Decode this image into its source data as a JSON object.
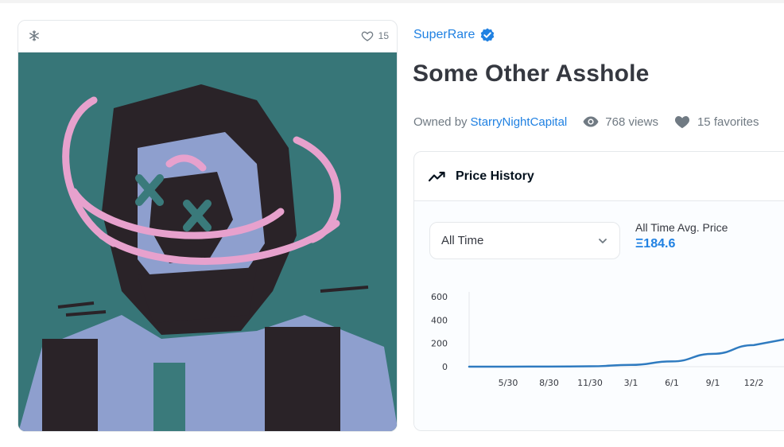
{
  "nft_card": {
    "chain_icon": "snowflake-icon",
    "favorite_icon": "heart-outline-icon",
    "favorite_count": "15"
  },
  "collection": {
    "name": "SuperRare",
    "verified_icon": "verified-badge-icon"
  },
  "title": "Some Other Asshole",
  "meta": {
    "owned_label": "Owned by",
    "owner": "StarryNightCapital",
    "views": "768 views",
    "favorites": "15 favorites"
  },
  "price_history": {
    "title": "Price History",
    "icon": "trending-up-icon",
    "period": "All Time",
    "avg_label": "All Time Avg. Price",
    "avg_value": "Ξ184.6"
  },
  "colors": {
    "accent": "#2081e2",
    "line": "#2f7bc0",
    "artwork_bg": "#3a7a7b"
  },
  "chart_data": {
    "type": "line",
    "y_ticks": [
      "600",
      "400",
      "200",
      "0"
    ],
    "x_ticks": [
      "5/30",
      "8/30",
      "11/30",
      "3/1",
      "6/1",
      "9/1",
      "12/2"
    ],
    "ylim": [
      0,
      600
    ],
    "series": [
      {
        "x": [
          "5/30",
          "8/30",
          "11/30",
          "3/1",
          "6/1",
          "9/1",
          "12/2"
        ],
        "values": [
          0,
          1,
          3,
          15,
          45,
          110,
          185
        ]
      }
    ],
    "grid": false
  }
}
